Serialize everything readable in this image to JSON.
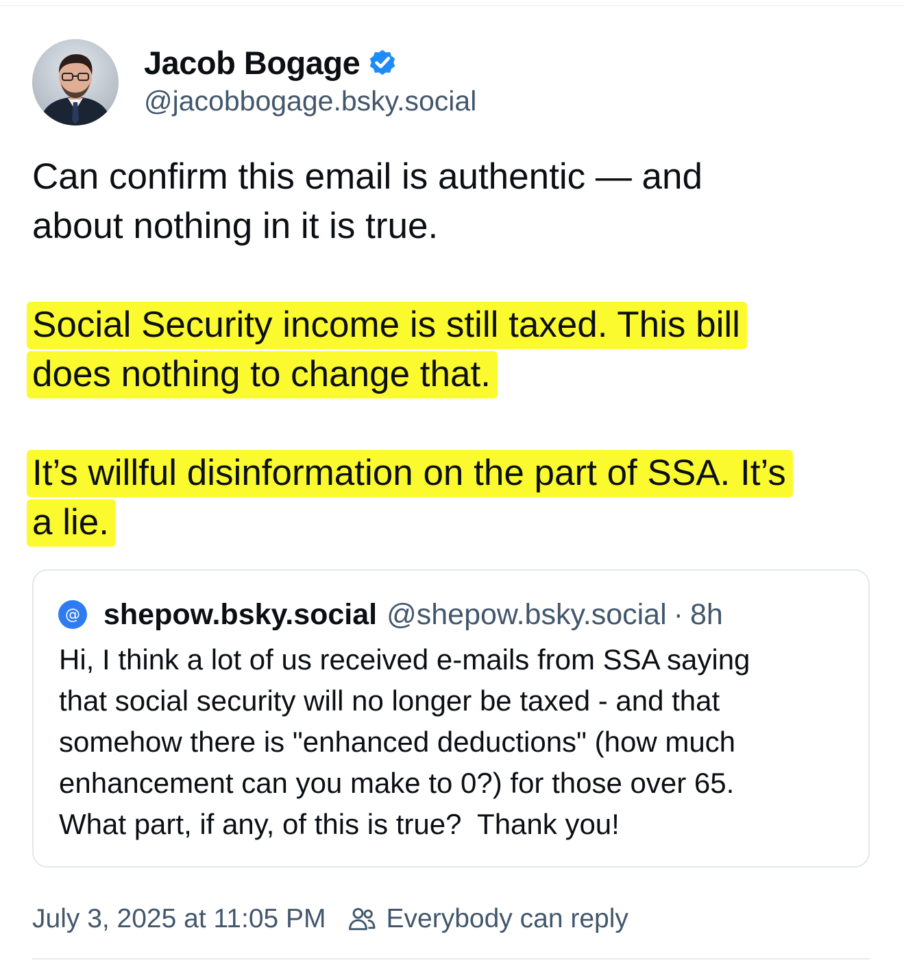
{
  "post": {
    "author": {
      "display_name": "Jacob Bogage",
      "handle": "@jacobbogage.bsky.social",
      "verified": true,
      "avatar_icon": "profile-photo"
    },
    "text": {
      "paragraph1_line1": "Can confirm this email is authentic — and",
      "paragraph1_line2": "about nothing in it is true.",
      "paragraph2_line1": "Social Security income is still taxed. This bill",
      "paragraph2_line2": "does nothing to change that.",
      "paragraph3_line1": "It’s willful disinformation on the part of SSA. It’s",
      "paragraph3_line2": "a lie."
    },
    "quote": {
      "avatar_glyph": "@",
      "display_name": "shepow.bsky.social",
      "handle": "@shepow.bsky.social",
      "separator": "·",
      "time": "8h",
      "body": "Hi, I think a lot of us received e-mails from SSA saying\nthat social security will no longer be taxed - and that\nsomehow there is \"enhanced deductions\" (how much\nenhancement can you make to 0?) for those over 65.\nWhat part, if any, of this is true?  Thank you!"
    },
    "meta": {
      "date": "July 3, 2025 at 11:05 PM",
      "reply_setting": "Everybody can reply",
      "reply_icon": "people-icon"
    }
  },
  "colors": {
    "highlight": "#fbfa2f",
    "verified_badge": "#1d8cf8",
    "secondary_text": "#42576c",
    "quote_avatar": "#2f7bf0"
  }
}
